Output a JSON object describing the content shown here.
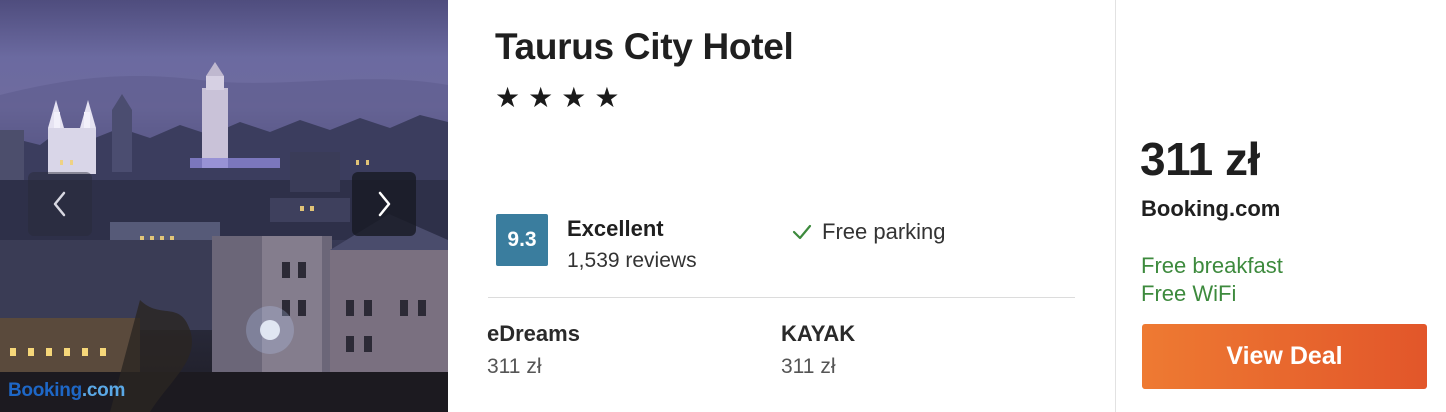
{
  "hotel": {
    "name": "Taurus City Hotel",
    "stars": 4,
    "star_glyph": "★"
  },
  "photo": {
    "watermark_part1": "Booking",
    "watermark_part2": ".com",
    "prev_icon": "chevron-left-icon",
    "next_icon": "chevron-right-icon"
  },
  "rating": {
    "score": "9.3",
    "label": "Excellent",
    "reviews": "1,539 reviews",
    "badge_color": "#3a7d9e"
  },
  "amenity": {
    "icon": "checkmark-icon",
    "label": "Free parking",
    "icon_color": "#3d8a3d"
  },
  "providers": [
    {
      "name": "eDreams",
      "price": "311 zł"
    },
    {
      "name": "KAYAK",
      "price": "311 zł"
    }
  ],
  "deal": {
    "price": "311 zł",
    "source": "Booking.com",
    "perks": [
      "Free breakfast",
      "Free WiFi"
    ],
    "button_label": "View Deal",
    "button_color": "#e96a2e",
    "perk_color": "#3d8a3d"
  }
}
